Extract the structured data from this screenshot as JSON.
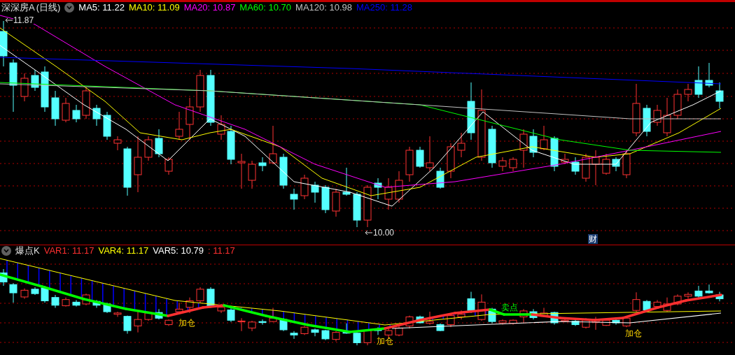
{
  "main_chart": {
    "security": "深深房A",
    "period": "(日线)",
    "indicators": [
      {
        "text": "MA5: 11.22",
        "color": "#ffffff"
      },
      {
        "text": "MA10: 11.09",
        "color": "#ffff00"
      },
      {
        "text": "MA20: 10.87",
        "color": "#ff00ff"
      },
      {
        "text": "MA60: 10.70",
        "color": "#00ff00"
      },
      {
        "text": "MA120: 10.98",
        "color": "#c0c0c0"
      },
      {
        "text": "MA250: 11.28",
        "color": "#0000ff"
      }
    ],
    "high_marker": "11.87",
    "low_marker": "10.00",
    "badge": "财"
  },
  "sub_chart": {
    "name": "爆点K",
    "indicators": [
      {
        "text": "VAR1: 11.17",
        "color": "#ff3030"
      },
      {
        "text": "VAR4: 11.17",
        "color": "#ffff00"
      },
      {
        "text": "VAR5: 10.79",
        "color": "#ffffff"
      },
      {
        "text": ": 11.17",
        "color": "#ff3030"
      }
    ],
    "signals": [
      {
        "text": "加仓",
        "kind": "buy"
      },
      {
        "text": "加仓",
        "kind": "buy"
      },
      {
        "text": "卖点",
        "kind": "sell"
      },
      {
        "text": "加仓",
        "kind": "buy"
      }
    ]
  }
}
